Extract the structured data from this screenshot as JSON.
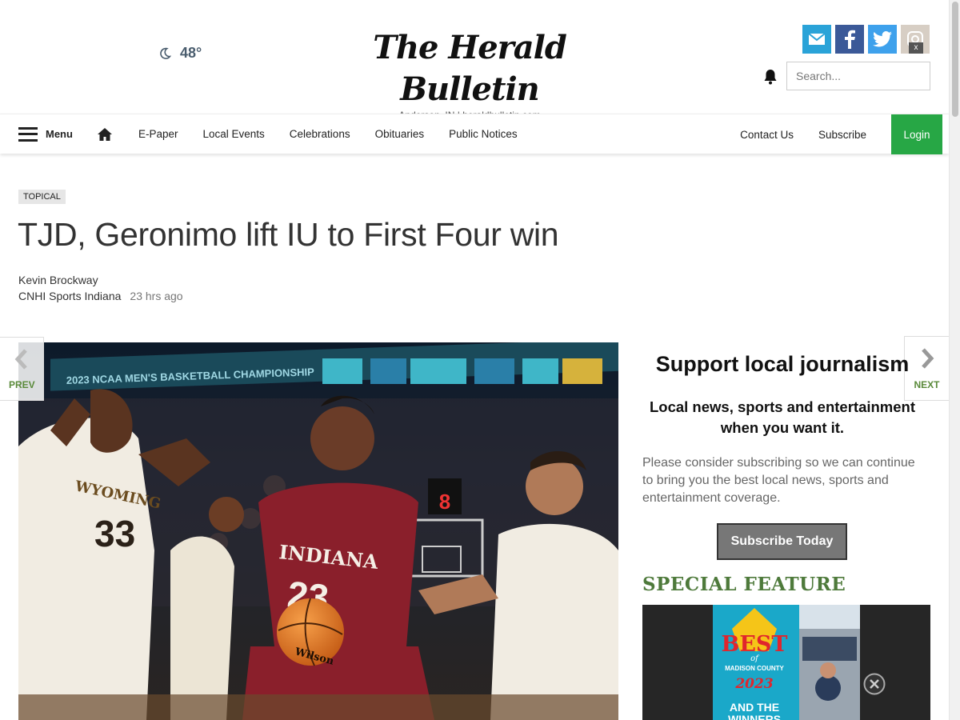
{
  "weather": {
    "temp": "48°",
    "icon": "moon-icon"
  },
  "masthead": {
    "name": "The Herald Bulletin",
    "subline": "Anderson, IN | heraldbulletin.com"
  },
  "social": [
    {
      "name": "email",
      "icon": "envelope-icon",
      "color": "#2aa3d8"
    },
    {
      "name": "facebook",
      "icon": "facebook-icon",
      "color": "#3b5998"
    },
    {
      "name": "twitter",
      "icon": "twitter-icon",
      "color": "#3ea1ec"
    },
    {
      "name": "instagram",
      "icon": "instagram-icon",
      "color": "#d7cec4"
    }
  ],
  "search": {
    "placeholder": "Search..."
  },
  "nav": {
    "menu_label": "Menu",
    "links": [
      "E-Paper",
      "Local Events",
      "Celebrations",
      "Obituaries",
      "Public Notices"
    ],
    "right_links": [
      "Contact Us",
      "Subscribe"
    ],
    "login": "Login"
  },
  "article": {
    "tag": "TOPICAL",
    "headline": "TJD, Geronimo lift IU to First Four win",
    "author": "Kevin Brockway",
    "source": "CNHI Sports Indiana",
    "time": "23 hrs ago"
  },
  "pager": {
    "prev": "PREV",
    "next": "NEXT"
  },
  "sidebar": {
    "title": "Support local journalism",
    "subtitle": "Local news, sports and entertainment when you want it.",
    "body": "Please consider subscribing so we can continue to bring you the best local news, sports and entertainment coverage.",
    "button": "Subscribe Today",
    "special": "SPECIAL FEATURE",
    "feature_best": "BEST",
    "feature_of": "of",
    "feature_county": "MADISON COUNTY",
    "feature_year": "2023",
    "feature_and": "AND THE",
    "feature_winners": "WINNERS"
  },
  "photo": {
    "banner_text": "2023 NCAA MEN'S BASKETBALL CHAMPIONSHIP",
    "jersey_left": "WYOMING",
    "num_left": "33",
    "jersey_center": "INDIANA",
    "num_center": "23",
    "ball_text": "Wilson",
    "shot_clock": "8"
  }
}
